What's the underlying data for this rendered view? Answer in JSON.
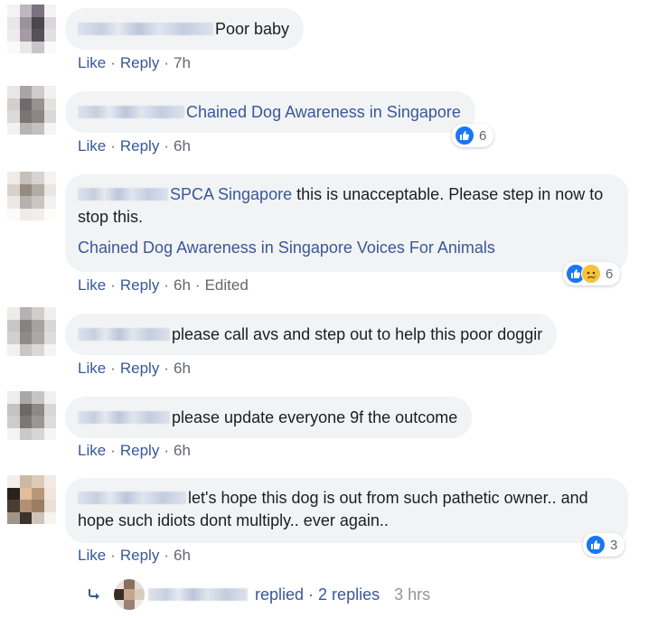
{
  "labels": {
    "like": "Like",
    "reply": "Reply",
    "dot": "·"
  },
  "colors": {
    "link": "#385898",
    "meta": "#606770",
    "bubble": "#f2f3f5",
    "like_blue": "#1877f2",
    "sad_yellow": "#f7c23a"
  },
  "icons": {
    "like": "like-reaction-icon",
    "sad": "sad-reaction-icon",
    "reply_arrow": "reply-arrow-icon"
  },
  "comments": [
    {
      "text": "Poor baby",
      "time": "7h"
    },
    {
      "tag": "Chained Dog Awareness in Singapore",
      "time": "6h",
      "reactions": {
        "count": "6"
      }
    },
    {
      "tag": "SPCA Singapore",
      "text": " this is unacceptable. Please step in now to stop this.",
      "tags_line": "Chained Dog Awareness in Singapore Voices For Animals",
      "time": "6h",
      "edited": "Edited",
      "reactions": {
        "count": "6"
      }
    },
    {
      "text": "please call avs and step out to help this poor doggir",
      "time": "6h"
    },
    {
      "text": "please update everyone 9f the outcome",
      "time": "6h"
    },
    {
      "text": "let's hope this dog is out from such pathetic owner.. and hope such idiots dont multiply.. ever again..",
      "time": "6h",
      "reactions": {
        "count": "3"
      }
    }
  ],
  "replies_summary": {
    "replied": "replied",
    "dot": "·",
    "count_label": "2 replies",
    "time": "3 hrs"
  }
}
